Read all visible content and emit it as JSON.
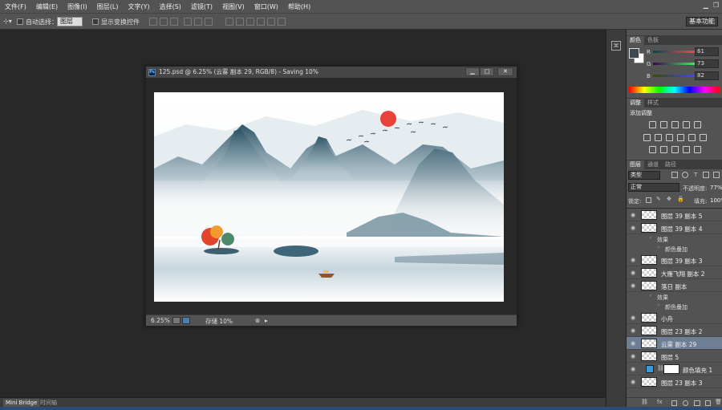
{
  "menu": [
    "文件(F)",
    "编辑(E)",
    "图像(I)",
    "图层(L)",
    "文字(Y)",
    "选择(S)",
    "滤镜(T)",
    "视图(V)",
    "窗口(W)",
    "帮助(H)"
  ],
  "options": {
    "auto_select_label": "自动选择：",
    "auto_select_value": "图层",
    "show_transform_label": "显示变换控件",
    "workspace": "基本功能"
  },
  "document": {
    "title": "125.psd @ 6.25% (云雾 副本 29, RGB/8) - Saving 10%",
    "zoom": "6.25%",
    "status": "存储 10%"
  },
  "bottom_tabs": [
    "Mini Bridge",
    "时间轴"
  ],
  "color_panel": {
    "tabs": [
      "颜色",
      "色板"
    ],
    "r_label": "R",
    "g_label": "G",
    "b_label": "B",
    "r": "61",
    "g": "73",
    "b": "82",
    "fg": "#3d4952"
  },
  "adjust_panel": {
    "tabs": [
      "调整",
      "样式"
    ],
    "title": "添加调整"
  },
  "layers_panel": {
    "tabs": [
      "图层",
      "通道",
      "路径"
    ],
    "kind": "类型",
    "blend": "正常",
    "opacity_label": "不透明度:",
    "opacity": "77%",
    "lock_label": "锁定:",
    "fill_label": "填充:",
    "fill": "100%",
    "layers": [
      {
        "name": "图层 39 副本 5",
        "type": "layer"
      },
      {
        "name": "图层 39 副本 4",
        "type": "layer"
      },
      {
        "name": "效果",
        "type": "effect"
      },
      {
        "name": "颜色叠加",
        "type": "subeffect"
      },
      {
        "name": "图层 39 副本 3",
        "type": "layer"
      },
      {
        "name": "大雁飞翔 副本 2",
        "type": "layer"
      },
      {
        "name": "落日 副本",
        "type": "layer"
      },
      {
        "name": "效果",
        "type": "effect"
      },
      {
        "name": "颜色叠加",
        "type": "subeffect"
      },
      {
        "name": "小舟",
        "type": "layer"
      },
      {
        "name": "图层 23 副本 2",
        "type": "layer"
      },
      {
        "name": "云雾 副本 29",
        "type": "layer",
        "selected": true
      },
      {
        "name": "图层 5",
        "type": "layer"
      },
      {
        "name": "颜色填充 1",
        "type": "fill"
      },
      {
        "name": "图层 23 副本 3",
        "type": "layer"
      }
    ]
  },
  "colors": {
    "sun": "#e8423a",
    "mountain": "#3f6578",
    "tree_red": "#e2452a",
    "tree_orange": "#f29a2e"
  }
}
